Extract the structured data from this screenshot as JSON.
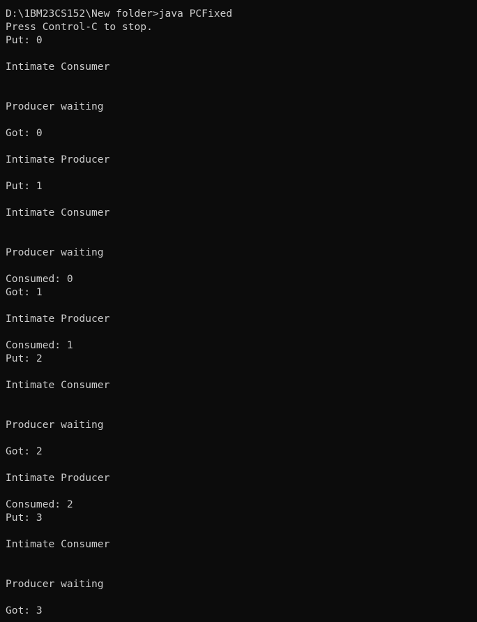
{
  "terminal": {
    "lines": [
      "D:\\1BM23CS152\\New folder>java PCFixed",
      "Press Control-C to stop.",
      "Put: 0",
      "",
      "Intimate Consumer",
      "",
      "",
      "Producer waiting",
      "",
      "Got: 0",
      "",
      "Intimate Producer",
      "",
      "Put: 1",
      "",
      "Intimate Consumer",
      "",
      "",
      "Producer waiting",
      "",
      "Consumed: 0",
      "Got: 1",
      "",
      "Intimate Producer",
      "",
      "Consumed: 1",
      "Put: 2",
      "",
      "Intimate Consumer",
      "",
      "",
      "Producer waiting",
      "",
      "Got: 2",
      "",
      "Intimate Producer",
      "",
      "Consumed: 2",
      "Put: 3",
      "",
      "Intimate Consumer",
      "",
      "",
      "Producer waiting",
      "",
      "Got: 3"
    ]
  }
}
